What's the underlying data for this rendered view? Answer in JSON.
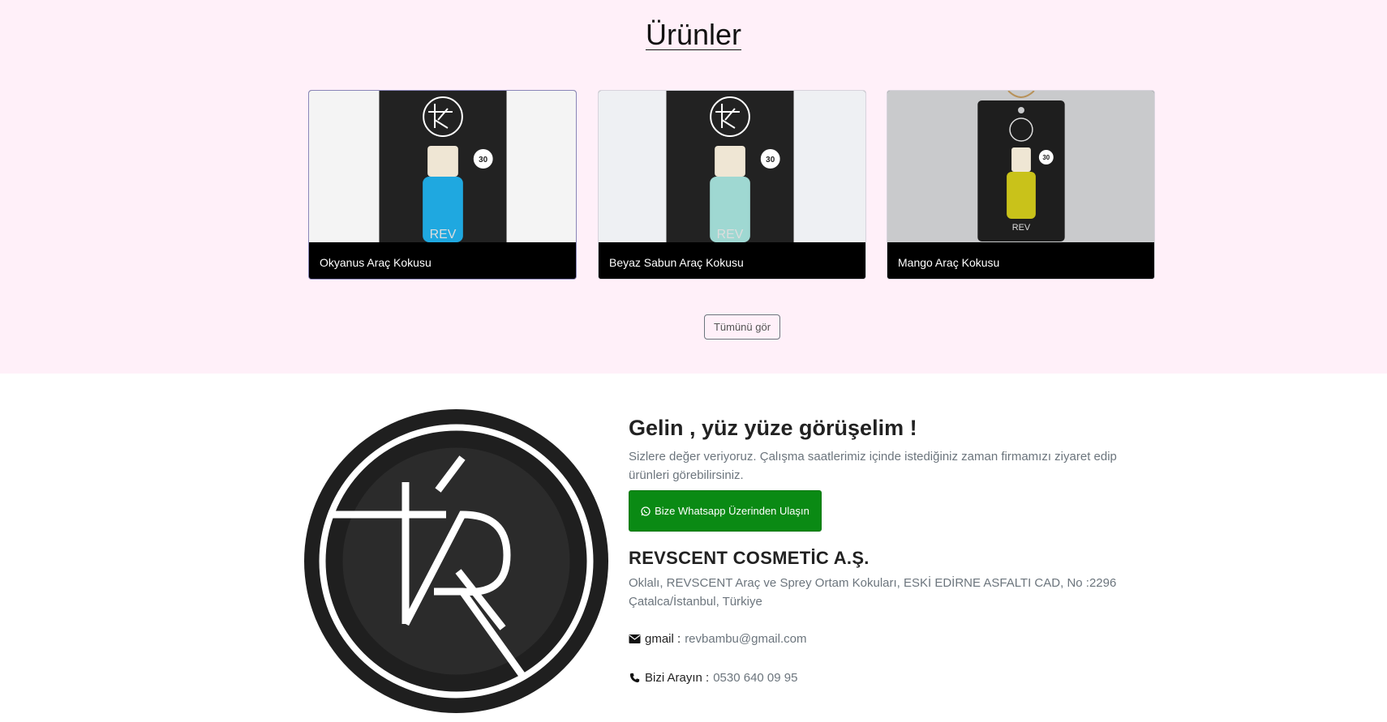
{
  "products": {
    "title": "Ürünler",
    "items": [
      {
        "name": "Okyanus Araç Kokusu",
        "liquid_color": "#1fa8e0"
      },
      {
        "name": "Beyaz Sabun Araç Kokusu",
        "liquid_color": "#9fd8d2"
      },
      {
        "name": "Mango Araç Kokusu",
        "liquid_color": "#c9c21a"
      }
    ],
    "view_all_label": "Tümünü gör"
  },
  "contact": {
    "title": "Gelin , yüz yüze görüşelim !",
    "description": "Sizlere değer veriyoruz. Çalışma saatlerimiz içinde istediğiniz zaman firmamızı ziyaret edip ürünleri görebilirsiniz.",
    "whatsapp_label": "Bize Whatsapp Üzerinden Ulaşın",
    "company": "REVSCENT COSMETİC A.Ş.",
    "address": "Oklalı, REVSCENT Araç ve Sprey Ortam Kokuları, ESKİ EDİRNE ASFALTI CAD, No :2296 Çatalca/İstanbul, Türkiye",
    "email_label": "gmail :",
    "email": "revbambu@gmail.com",
    "phone_label": "Bizi Arayın :",
    "phone": "0530 640 09 95"
  },
  "icons": {
    "logo": "rk-monogram-logo",
    "whatsapp": "whatsapp-icon",
    "email": "envelope-icon",
    "phone": "phone-icon"
  },
  "colors": {
    "products_bg": "#fff0f9",
    "whatsapp_green": "#0a8a14",
    "caption_bg": "#000000"
  }
}
